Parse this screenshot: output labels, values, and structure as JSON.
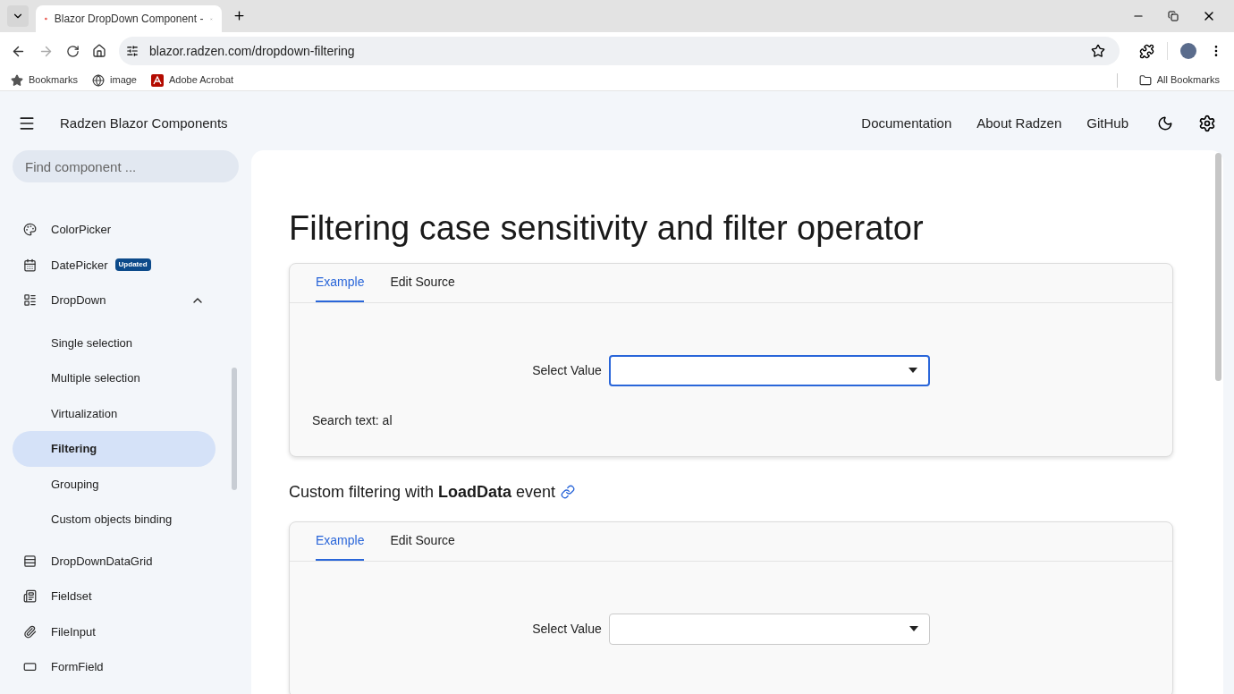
{
  "browser": {
    "tab": {
      "title": "Blazor DropDown Component -"
    },
    "address": "blazor.radzen.com/dropdown-filtering",
    "bookmarks": [
      {
        "kind": "star",
        "label": "Bookmarks"
      },
      {
        "kind": "globe",
        "label": "image"
      },
      {
        "kind": "pdf",
        "label": "Adobe Acrobat"
      }
    ],
    "all_bookmarks": "All Bookmarks"
  },
  "header": {
    "title": "Radzen Blazor Components",
    "links": [
      "Documentation",
      "About Radzen",
      "GitHub"
    ]
  },
  "sidebar": {
    "search": {
      "placeholder": "Find component ..."
    },
    "items": [
      {
        "kind": "palette",
        "label": "ColorPicker"
      },
      {
        "kind": "calendar",
        "label": "DatePicker",
        "badge": "Updated"
      },
      {
        "kind": "list",
        "label": "DropDown",
        "expanded": true,
        "children": [
          {
            "label": "Single selection",
            "selected": false
          },
          {
            "label": "Multiple selection",
            "selected": false
          },
          {
            "label": "Virtualization",
            "selected": false
          },
          {
            "label": "Filtering",
            "selected": true
          },
          {
            "label": "Grouping",
            "selected": false
          },
          {
            "label": "Custom objects binding",
            "selected": false
          }
        ]
      },
      {
        "kind": "grid",
        "label": "DropDownDataGrid"
      },
      {
        "kind": "form",
        "label": "Fieldset"
      },
      {
        "kind": "clip",
        "label": "FileInput"
      },
      {
        "kind": "field",
        "label": "FormField"
      }
    ]
  },
  "content": {
    "title": "Filtering case sensitivity and filter operator",
    "examples": [
      {
        "tabs": [
          {
            "label": "Example",
            "selected": true
          },
          {
            "label": "Edit Source",
            "selected": false
          }
        ],
        "field_label": "Select Value",
        "focused": true,
        "note": "Search text: al"
      },
      {
        "heading": "Custom filtering with **LoadData** event",
        "tabs": [
          {
            "label": "Example",
            "selected": true
          },
          {
            "label": "Edit Source",
            "selected": false
          }
        ],
        "field_label": "Select Value",
        "focused": false
      }
    ]
  }
}
